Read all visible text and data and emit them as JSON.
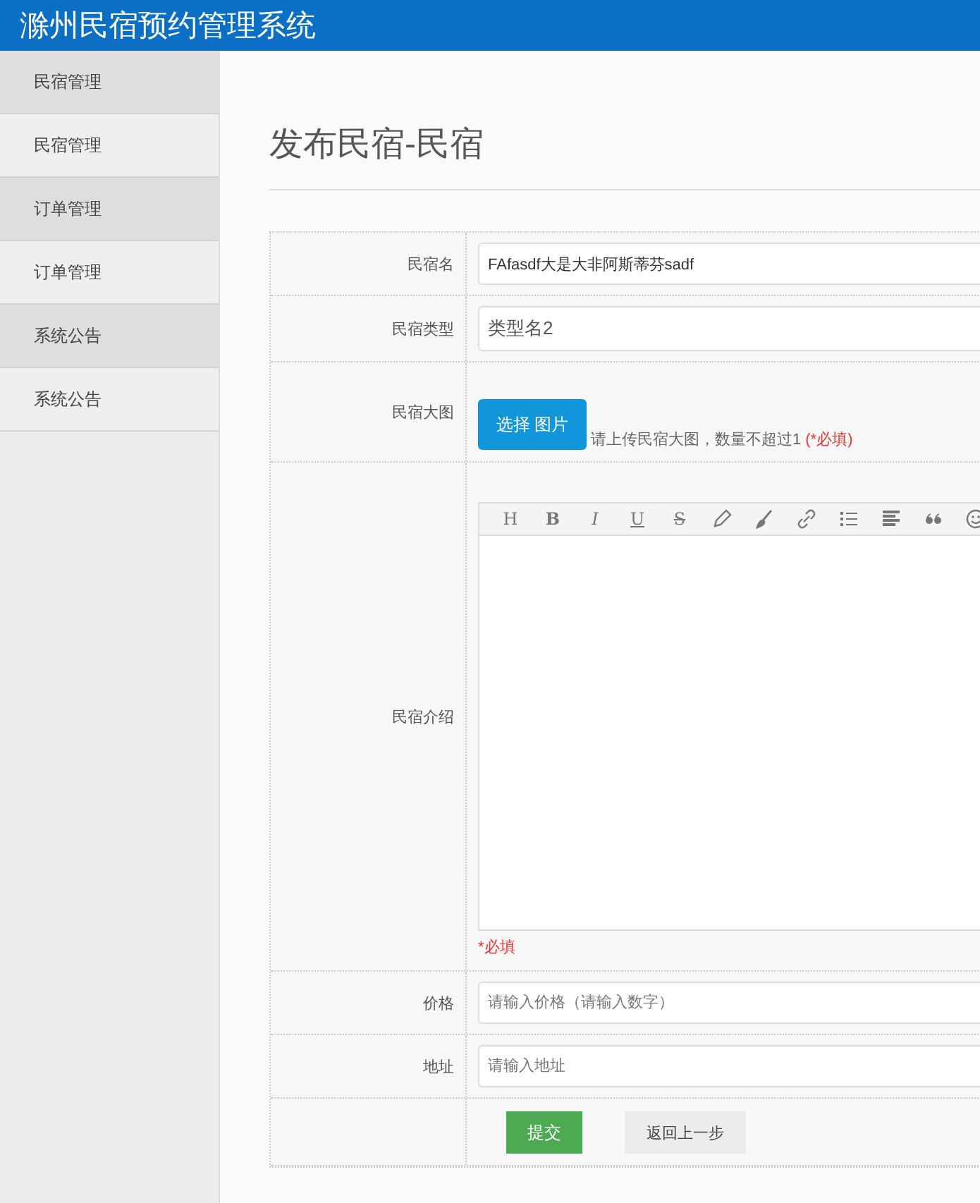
{
  "header": {
    "title": "滁州民宿预约管理系统"
  },
  "sidebar": {
    "groups": [
      {
        "title": "民宿管理",
        "items": [
          {
            "label": "民宿管理",
            "selected": false
          }
        ]
      },
      {
        "title": "订单管理",
        "items": [
          {
            "label": "订单管理",
            "selected": false
          }
        ]
      },
      {
        "title": "系统公告",
        "items": [
          {
            "label": "系统公告",
            "selected": false
          }
        ]
      }
    ]
  },
  "page_title": "发布民宿-民宿",
  "form": {
    "rows": [
      {
        "kind": "input",
        "label": "民宿名",
        "value": "FAfasdf大是大非阿斯蒂芬sadf"
      },
      {
        "kind": "select",
        "label": "民宿类型",
        "value": "类型名2"
      },
      {
        "kind": "upload",
        "label": "民宿大图",
        "button": "选择 图片",
        "hint": "请上传民宿大图，数量不超过1",
        "required": "(*必填)"
      },
      {
        "kind": "editor",
        "label": "民宿介绍",
        "toolbar": [
          {
            "kind": "letter",
            "label": "H"
          },
          {
            "kind": "letter",
            "label": "B"
          },
          {
            "kind": "letter",
            "label": "I"
          },
          {
            "kind": "letter",
            "label": "U"
          },
          {
            "kind": "letter",
            "label": "S"
          },
          {
            "kind": "pencil"
          },
          {
            "kind": "brush"
          },
          {
            "kind": "link"
          },
          {
            "kind": "list"
          },
          {
            "kind": "align"
          },
          {
            "kind": "quote"
          },
          {
            "kind": "emoji"
          }
        ],
        "required": "*必填"
      },
      {
        "kind": "input",
        "label": "价格",
        "placeholder": "请输入价格（请输入数字）"
      },
      {
        "kind": "input",
        "label": "地址",
        "placeholder": "请输入地址"
      }
    ],
    "buttons": [
      {
        "kind": "primary",
        "label": "提交"
      },
      {
        "kind": "default",
        "label": "返回上一步"
      }
    ]
  }
}
